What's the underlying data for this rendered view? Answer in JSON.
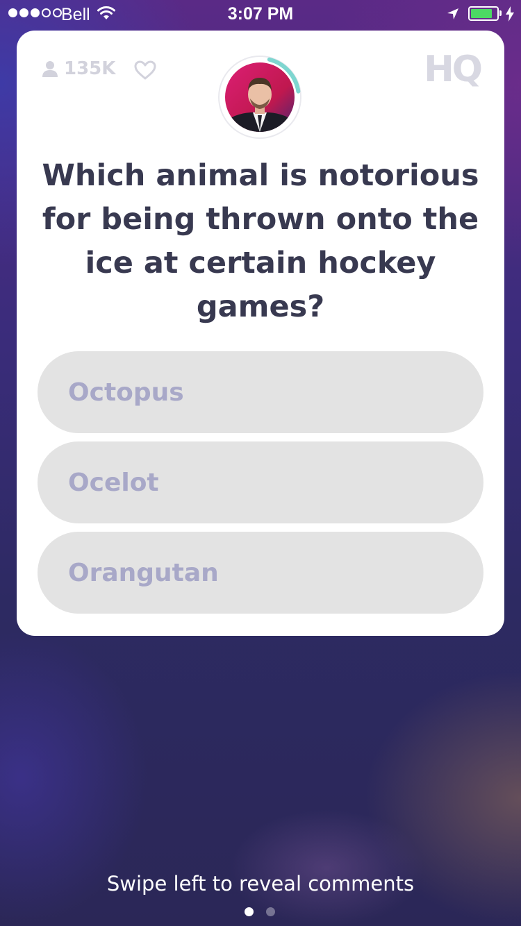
{
  "status_bar": {
    "carrier": "Bell",
    "time": "3:07 PM",
    "signal_bars_filled": 3,
    "signal_bars_total": 5,
    "battery_level": 0.85,
    "icons": [
      "wifi-icon",
      "location-arrow-icon",
      "battery-icon",
      "charging-bolt-icon"
    ]
  },
  "card": {
    "viewer_count": "135K",
    "logo_text": "HQ",
    "icons": [
      "person-icon",
      "heart-icon",
      "host-avatar"
    ],
    "timer_color": "#7ed6d0",
    "question": "Which animal is notorious for being thrown onto the ice at certain hockey games?",
    "answers": [
      {
        "label": "Octopus"
      },
      {
        "label": "Ocelot"
      },
      {
        "label": "Orangutan"
      }
    ]
  },
  "footer": {
    "swipe_hint": "Swipe left to reveal comments",
    "page_count": 2,
    "active_page": 1
  }
}
